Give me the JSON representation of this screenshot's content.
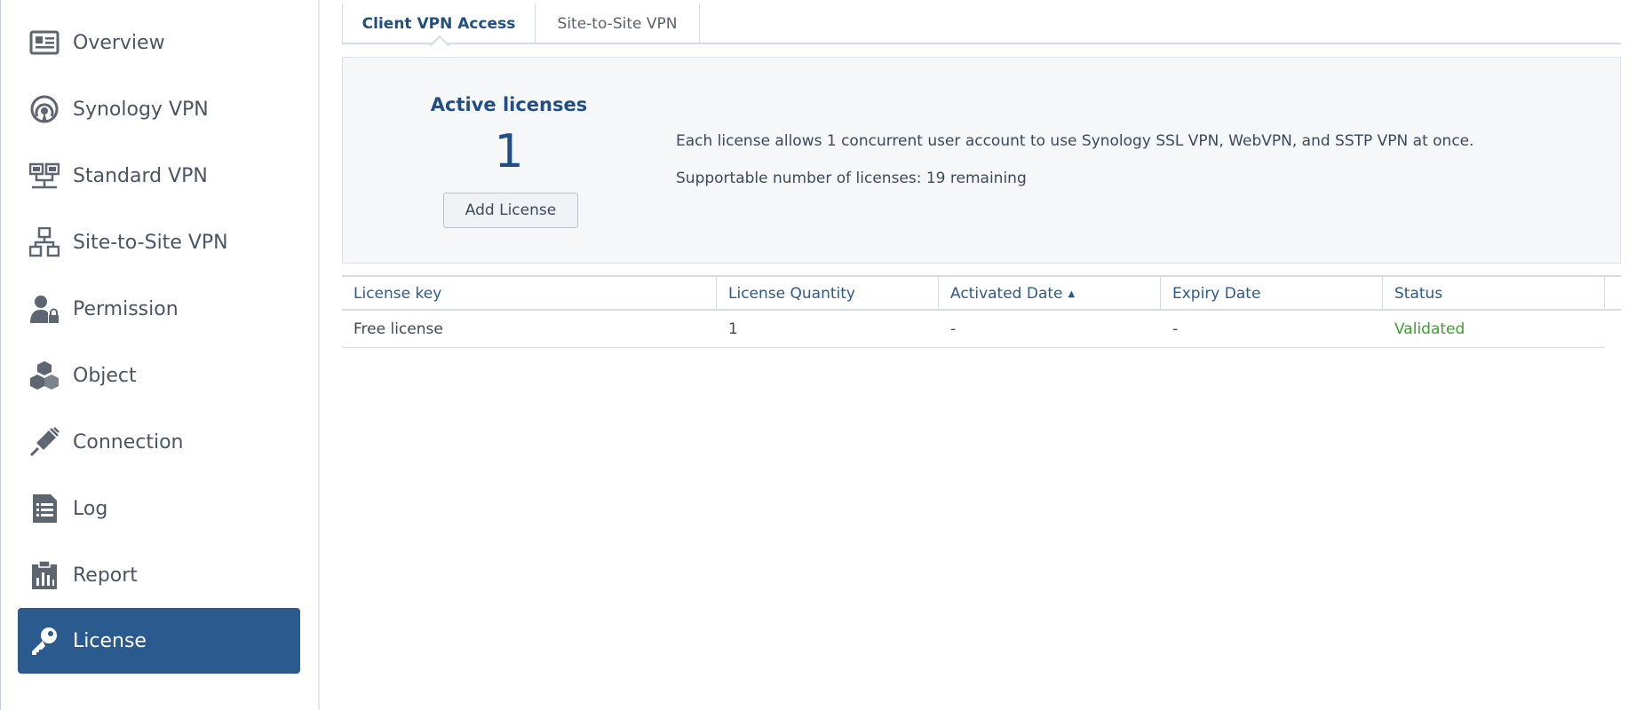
{
  "sidebar": {
    "items": [
      {
        "label": "Overview",
        "icon": "overview-icon"
      },
      {
        "label": "Synology VPN",
        "icon": "synology-vpn-icon"
      },
      {
        "label": "Standard VPN",
        "icon": "standard-vpn-icon"
      },
      {
        "label": "Site-to-Site VPN",
        "icon": "site-to-site-icon"
      },
      {
        "label": "Permission",
        "icon": "permission-icon"
      },
      {
        "label": "Object",
        "icon": "object-icon"
      },
      {
        "label": "Connection",
        "icon": "connection-icon"
      },
      {
        "label": "Log",
        "icon": "log-icon"
      },
      {
        "label": "Report",
        "icon": "report-icon"
      },
      {
        "label": "License",
        "icon": "key-icon",
        "selected": true
      }
    ]
  },
  "tabs": [
    {
      "label": "Client VPN Access",
      "active": true
    },
    {
      "label": "Site-to-Site VPN",
      "active": false
    }
  ],
  "license_panel": {
    "title": "Active licenses",
    "count": "1",
    "add_button": "Add License",
    "description": "Each license allows 1 concurrent user account to use Synology SSL VPN, WebVPN, and SSTP VPN at once.",
    "supportable": "Supportable number of licenses: 19 remaining"
  },
  "table": {
    "columns": [
      "License key",
      "License Quantity",
      "Activated Date",
      "Expiry Date",
      "Status"
    ],
    "sort_column": "Activated Date",
    "sort_direction": "ascending",
    "rows": [
      [
        "Free license",
        "1",
        "-",
        "-",
        "Validated"
      ]
    ]
  },
  "colors": {
    "accent": "#2b5a8e",
    "status_validated": "#3aa02c"
  }
}
